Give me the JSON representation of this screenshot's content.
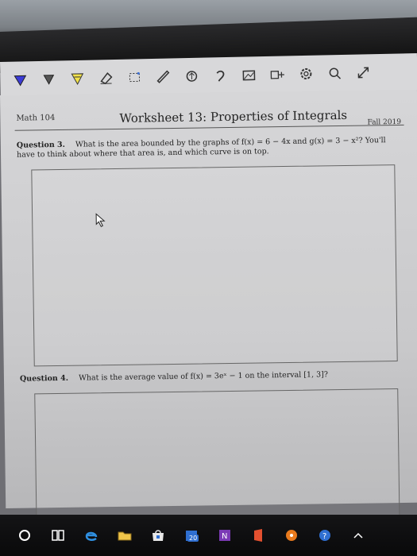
{
  "worksheet": {
    "course": "Math 104",
    "title": "Worksheet 13: Properties of Integrals",
    "term": "Fall 2019"
  },
  "question3": {
    "label": "Question 3.",
    "text": "What is the area bounded by the graphs of f(x) = 6 − 4x and g(x) = 3 − x²? You'll have to think about where that area is, and which curve is on top."
  },
  "question4": {
    "label": "Question 4.",
    "text": "What is the average value of f(x) = 3eˣ − 1 on the interval [1, 3]?"
  },
  "taskbar": {
    "calendar_badge": "20"
  },
  "colors": {
    "toolbar_bg": "#d8d8da",
    "page_bg": "#d6d6d8",
    "taskbar_bg": "#111111",
    "edge_blue": "#2f8fe0",
    "onenote_purple": "#7b3ab5"
  }
}
